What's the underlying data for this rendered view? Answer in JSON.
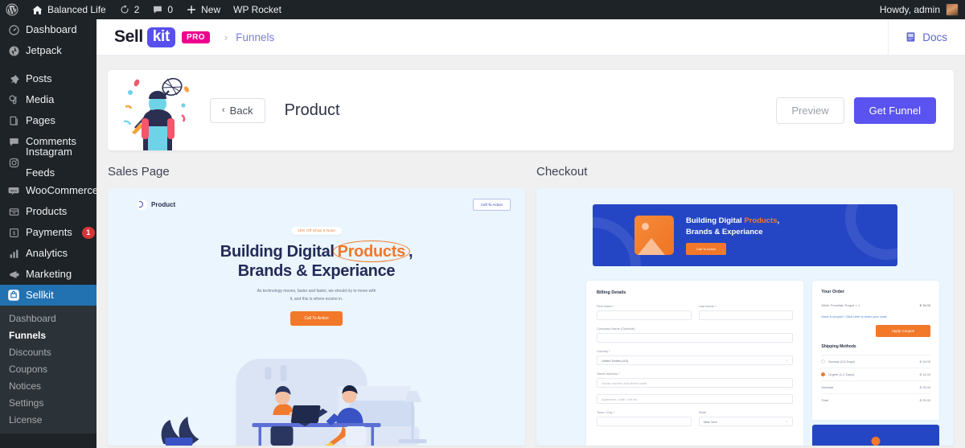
{
  "adminbar": {
    "site_name": "Balanced Life",
    "updates_count": "2",
    "comments_count": "0",
    "new_label": "New",
    "plugin_label": "WP Rocket",
    "howdy": "Howdy, admin",
    "icons": {
      "wordpress": "wordpress-logo-icon",
      "home": "home-icon",
      "updates": "updates-icon",
      "comments": "comment-bubble-icon",
      "new": "plus-icon",
      "avatar": "user-avatar"
    }
  },
  "sidebar": {
    "items": [
      {
        "label": "Dashboard",
        "icon": "dashboard-icon",
        "badge": ""
      },
      {
        "label": "Jetpack",
        "icon": "jetpack-icon",
        "badge": ""
      },
      {
        "label": "Posts",
        "icon": "pin-icon",
        "badge": ""
      },
      {
        "label": "Media",
        "icon": "media-icon",
        "badge": ""
      },
      {
        "label": "Pages",
        "icon": "pages-icon",
        "badge": ""
      },
      {
        "label": "Comments",
        "icon": "comment-bubble-icon",
        "badge": ""
      },
      {
        "label": "Instagram Feeds",
        "icon": "instagram-icon",
        "badge": ""
      },
      {
        "label": "WooCommerce",
        "icon": "woocommerce-icon",
        "badge": ""
      },
      {
        "label": "Products",
        "icon": "products-icon",
        "badge": ""
      },
      {
        "label": "Payments",
        "icon": "payments-icon",
        "badge": "1"
      },
      {
        "label": "Analytics",
        "icon": "bar-chart-icon",
        "badge": ""
      },
      {
        "label": "Marketing",
        "icon": "megaphone-icon",
        "badge": ""
      },
      {
        "label": "Sellkit",
        "icon": "sellkit-bag-icon",
        "badge": ""
      }
    ],
    "submenu": [
      {
        "label": "Dashboard",
        "current": false
      },
      {
        "label": "Funnels",
        "current": true
      },
      {
        "label": "Discounts",
        "current": false
      },
      {
        "label": "Coupons",
        "current": false
      },
      {
        "label": "Notices",
        "current": false
      },
      {
        "label": "Settings",
        "current": false
      },
      {
        "label": "License",
        "current": false
      }
    ]
  },
  "topbar": {
    "brand_sell": "Sell",
    "brand_kit": "kit",
    "brand_pro": "PRO",
    "breadcrumb_separator": "›",
    "breadcrumb": "Funnels",
    "docs_label": "Docs",
    "docs_icon": "book-icon"
  },
  "header": {
    "back_label": "Back",
    "back_icon": "chevron-left-icon",
    "title": "Product",
    "preview_label": "Preview",
    "get_funnel_label": "Get Funnel",
    "illustration": "chef-with-whisk-illustration"
  },
  "previews": {
    "sales_page": {
      "label": "Sales Page",
      "nav_logo_text": "Product",
      "nav_cta": "Call To Action",
      "badge": "15% Off Shop It Now!",
      "headline_pre": "Building Digital",
      "headline_highlight": "Products",
      "headline_comma": ",",
      "headline_line2": "Brands & Experiance",
      "subtext_line1": "As technology moves, faster and faster, we should try to move with",
      "subtext_line2": "it, and this is where ecome in.",
      "cta": "Call To Action",
      "scene": "two-people-at-desk-illustration"
    },
    "checkout": {
      "label": "Checkout",
      "banner_headline_pre": "Building Digital",
      "banner_headline_highlight": "Products",
      "banner_headline_comma": ",",
      "banner_headline_line2": "Brands & Experiance",
      "banner_cta": "Call To Action",
      "billing": {
        "title": "Billing Details",
        "first_name_label": "First Name *",
        "last_name_label": "Last Name *",
        "company_label": "Company Name (Optional)",
        "country_label": "Country *",
        "country_value": "United States (US)",
        "street_label": "Street address *",
        "street_placeholder": "House number and street name",
        "street2_placeholder": "Apartment, suite, unit etc.",
        "town_label": "Town / City *",
        "state_label": "State",
        "state_value": "New York"
      },
      "order": {
        "title": "Your Order",
        "item_label": "White Porcelain Teapot  × 1",
        "item_amount": "$ 15.00",
        "coupon_text": "Have a coupon? Click here to enter your code",
        "apply_label": "Apply Coupon",
        "shipping_title": "Shipping Methods",
        "shipping_options": [
          {
            "label": "Normal (3-5 Days)",
            "amount": "$ 10.00",
            "selected": false
          },
          {
            "label": "Urgent (1-2 Days)",
            "amount": "$ 14.00",
            "selected": true
          }
        ],
        "subtotal_label": "Subtotal",
        "subtotal_amount": "$ 15.00",
        "total_label": "Total",
        "total_amount": "$ 29.00"
      }
    }
  },
  "colors": {
    "admin_dark": "#1d2327",
    "admin_active_blue": "#2271b1",
    "brand_purple": "#5850ec",
    "brand_pink": "#ec008c",
    "cta_purple": "#5a53f0",
    "accent_orange": "#f2782a",
    "checkout_blue": "#2546c4",
    "badge_red": "#d63638"
  }
}
